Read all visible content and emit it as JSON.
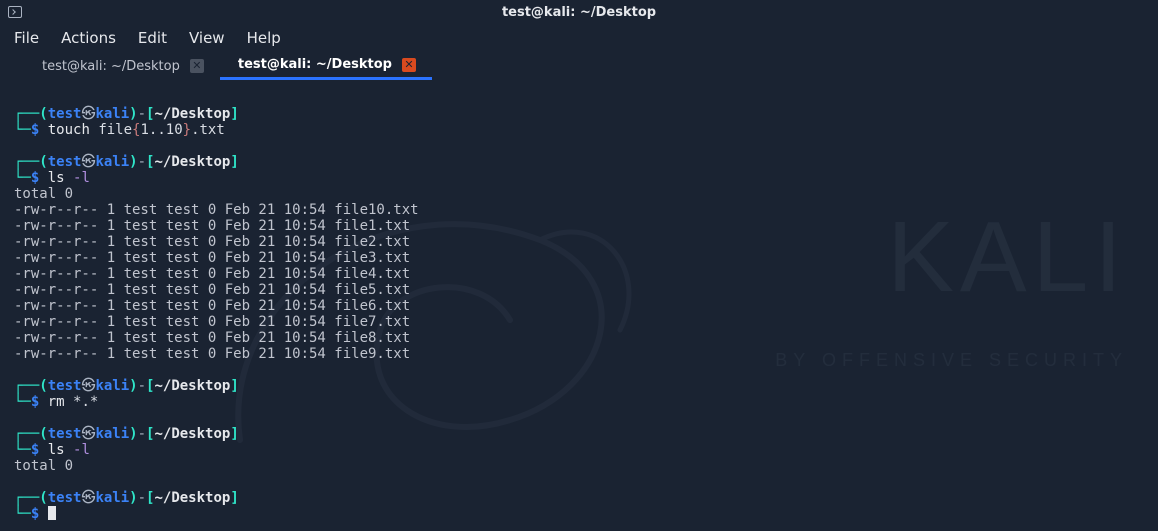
{
  "window": {
    "title": "test@kali: ~/Desktop"
  },
  "menu": {
    "file": "File",
    "actions": "Actions",
    "edit": "Edit",
    "view": "View",
    "help": "Help"
  },
  "tabs": {
    "inactive": "test@kali: ~/Desktop",
    "active": "test@kali: ~/Desktop"
  },
  "prompt": {
    "open": "┌──(",
    "user": "test",
    "at": "㉿",
    "host": "kali",
    "closeUserHost": ")",
    "dash": "-",
    "lb": "[",
    "path": "~/Desktop",
    "rb": "]",
    "line2start": "└─",
    "dollar": "$"
  },
  "cmds": {
    "touch": "touch",
    "touch_args_pre": " file",
    "touch_brace_open": "{",
    "touch_range": "1..10",
    "touch_brace_close": "}",
    "touch_args_post": ".txt",
    "ls": "ls",
    "ls_args": " -l",
    "rm": "rm",
    "rm_args": " *.*"
  },
  "listing": {
    "total": "total 0",
    "rows": [
      "-rw-r--r-- 1 test test 0 Feb 21 10:54 file10.txt",
      "-rw-r--r-- 1 test test 0 Feb 21 10:54 file1.txt",
      "-rw-r--r-- 1 test test 0 Feb 21 10:54 file2.txt",
      "-rw-r--r-- 1 test test 0 Feb 21 10:54 file3.txt",
      "-rw-r--r-- 1 test test 0 Feb 21 10:54 file4.txt",
      "-rw-r--r-- 1 test test 0 Feb 21 10:54 file5.txt",
      "-rw-r--r-- 1 test test 0 Feb 21 10:54 file6.txt",
      "-rw-r--r-- 1 test test 0 Feb 21 10:54 file7.txt",
      "-rw-r--r-- 1 test test 0 Feb 21 10:54 file8.txt",
      "-rw-r--r-- 1 test test 0 Feb 21 10:54 file9.txt"
    ],
    "total2": "total 0"
  },
  "bglogo": {
    "text": "KALI",
    "sub": "BY OFFENSIVE SECURITY"
  }
}
